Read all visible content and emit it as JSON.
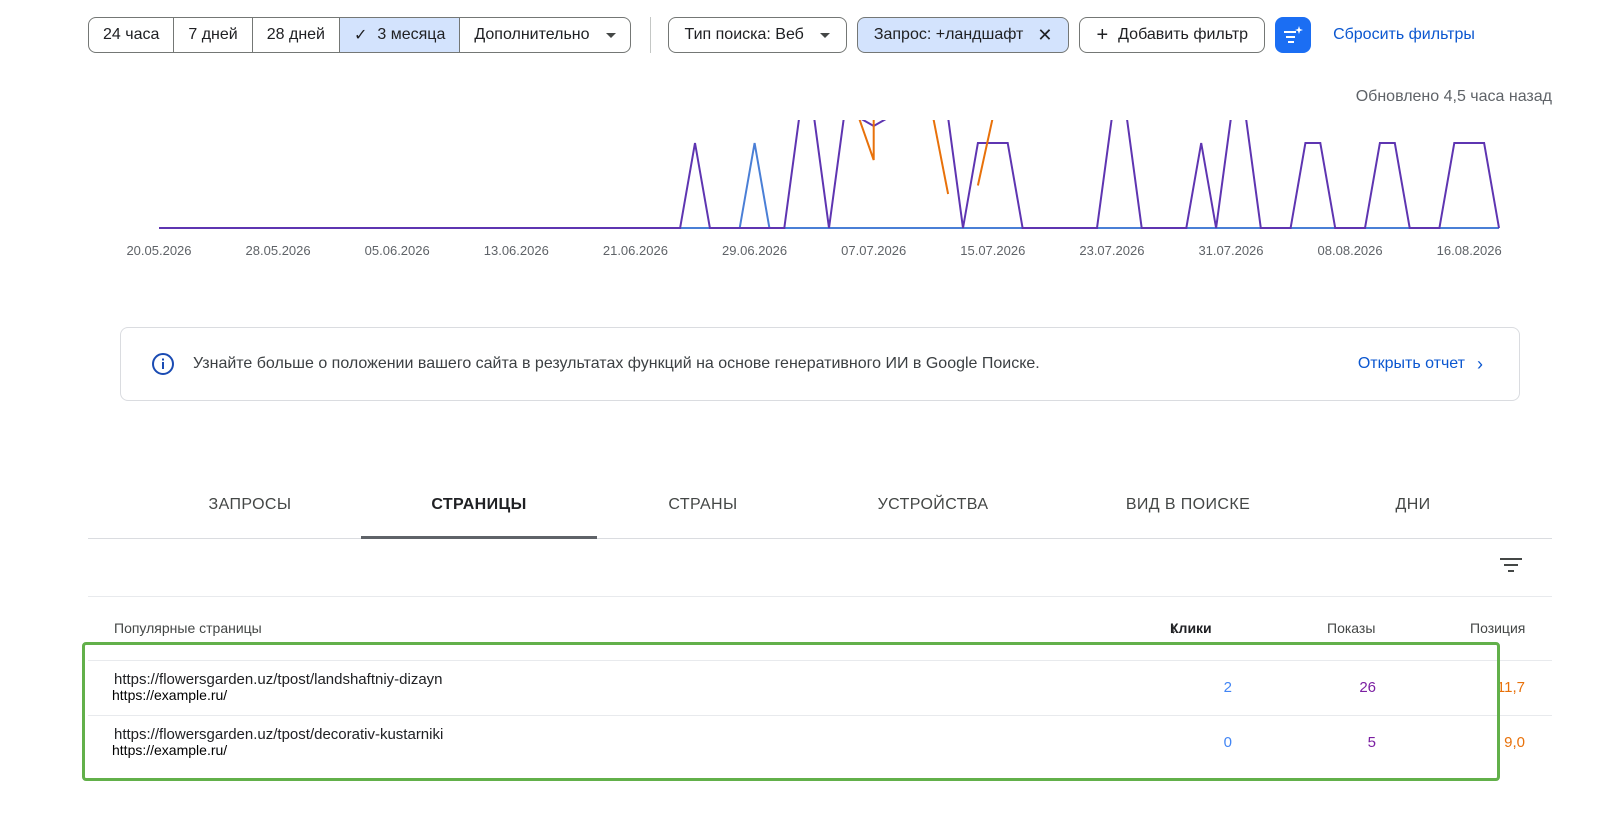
{
  "filters": {
    "date_ranges": [
      {
        "label": "24 часа",
        "active": false
      },
      {
        "label": "7 дней",
        "active": false
      },
      {
        "label": "28 дней",
        "active": false
      },
      {
        "label": "3 месяца",
        "active": true
      },
      {
        "label": "Дополнительно",
        "active": false
      }
    ],
    "search_type": "Тип поиска: Веб",
    "query_filter": "Запрос: +ландшафт",
    "add_filter": "Добавить фильтр",
    "reset": "Сбросить фильтры"
  },
  "updated_text": "Обновлено 4,5 часа назад",
  "chart_data": {
    "type": "line",
    "x_ticks": [
      "20.05.2026",
      "28.05.2026",
      "05.06.2026",
      "13.06.2026",
      "21.06.2026",
      "29.06.2026",
      "07.07.2026",
      "15.07.2026",
      "23.07.2026",
      "31.07.2026",
      "08.08.2026",
      "16.08.2026"
    ],
    "x_range": [
      "20.05.2026",
      "18.08.2026"
    ],
    "grid": false,
    "legend": "none",
    "series": [
      {
        "color": "#4a7fd6",
        "points": [
          [
            "20.05.2026",
            0
          ],
          [
            "28.06.2026",
            0
          ],
          [
            "29.06.2026",
            1
          ],
          [
            "30.06.2026",
            0
          ],
          [
            "18.08.2026",
            0
          ]
        ]
      },
      {
        "color": "#5e35b1",
        "points": [
          [
            "20.05.2026",
            0
          ],
          [
            "24.06.2026",
            0
          ],
          [
            "25.06.2026",
            1
          ],
          [
            "26.06.2026",
            0
          ],
          [
            "01.07.2026",
            0
          ],
          [
            "02.07.2026",
            1.3
          ],
          [
            "03.07.2026",
            1.3
          ],
          [
            "04.07.2026",
            0
          ],
          [
            "05.07.2026",
            1.3
          ],
          [
            "06.07.2026",
            1.3
          ],
          [
            "07.07.2026",
            1.2
          ],
          [
            "08.07.2026",
            1.3
          ],
          [
            "12.07.2026",
            1.3
          ],
          [
            "13.07.2026",
            0
          ],
          [
            "14.07.2026",
            1
          ],
          [
            "16.07.2026",
            1
          ],
          [
            "17.07.2026",
            0
          ],
          [
            "22.07.2026",
            0
          ],
          [
            "23.07.2026",
            1.3
          ],
          [
            "24.07.2026",
            1.3
          ],
          [
            "25.07.2026",
            0
          ],
          [
            "28.07.2026",
            0
          ],
          [
            "29.07.2026",
            1
          ],
          [
            "30.07.2026",
            0
          ],
          [
            "31.07.2026",
            1.3
          ],
          [
            "01.08.2026",
            1.3
          ],
          [
            "02.08.2026",
            0
          ],
          [
            "04.08.2026",
            0
          ],
          [
            "05.08.2026",
            1
          ],
          [
            "06.08.2026",
            1
          ],
          [
            "07.08.2026",
            0
          ],
          [
            "09.08.2026",
            0
          ],
          [
            "10.08.2026",
            1
          ],
          [
            "11.08.2026",
            1
          ],
          [
            "12.08.2026",
            0
          ],
          [
            "14.08.2026",
            0
          ],
          [
            "15.08.2026",
            1
          ],
          [
            "17.08.2026",
            1
          ],
          [
            "18.08.2026",
            0
          ]
        ]
      },
      {
        "color": "#e8710a",
        "points": [
          [
            "06.07.2026",
            1.3
          ],
          [
            "07.07.2026",
            0.8
          ],
          [
            "07.07.2026",
            1.3
          ]
        ]
      },
      {
        "color": "#e8710a",
        "points": [
          [
            "11.07.2026",
            1.3
          ],
          [
            "12.07.2026",
            0.4
          ]
        ]
      },
      {
        "color": "#e8710a",
        "points": [
          [
            "14.07.2026",
            0.5
          ],
          [
            "15.07.2026",
            1.3
          ]
        ]
      }
    ]
  },
  "banner": {
    "message": "Узнайте больше о положении вашего сайта в результатах функций на основе генеративного ИИ в Google Поиске.",
    "link": "Открыть отчет"
  },
  "tabs": [
    "ЗАПРОСЫ",
    "СТРАНИЦЫ",
    "СТРАНЫ",
    "УСТРОЙСТВА",
    "ВИД В ПОИСКЕ",
    "ДНИ"
  ],
  "active_tab": 1,
  "table": {
    "headers": {
      "page": "Популярные страницы",
      "clicks": "Клики",
      "impressions": "Показы",
      "position": "Позиция"
    },
    "rows": [
      {
        "url": "https://flowersgarden.uz/tpost/landshaftniy-dizayn",
        "overlay": "https://example.ru/",
        "clicks": "2",
        "impressions": "26",
        "position": "11,7"
      },
      {
        "url": "https://flowersgarden.uz/tpost/decorativ-kustarniki",
        "overlay": "https://example.ru/",
        "clicks": "0",
        "impressions": "5",
        "position": "9,0"
      }
    ]
  }
}
